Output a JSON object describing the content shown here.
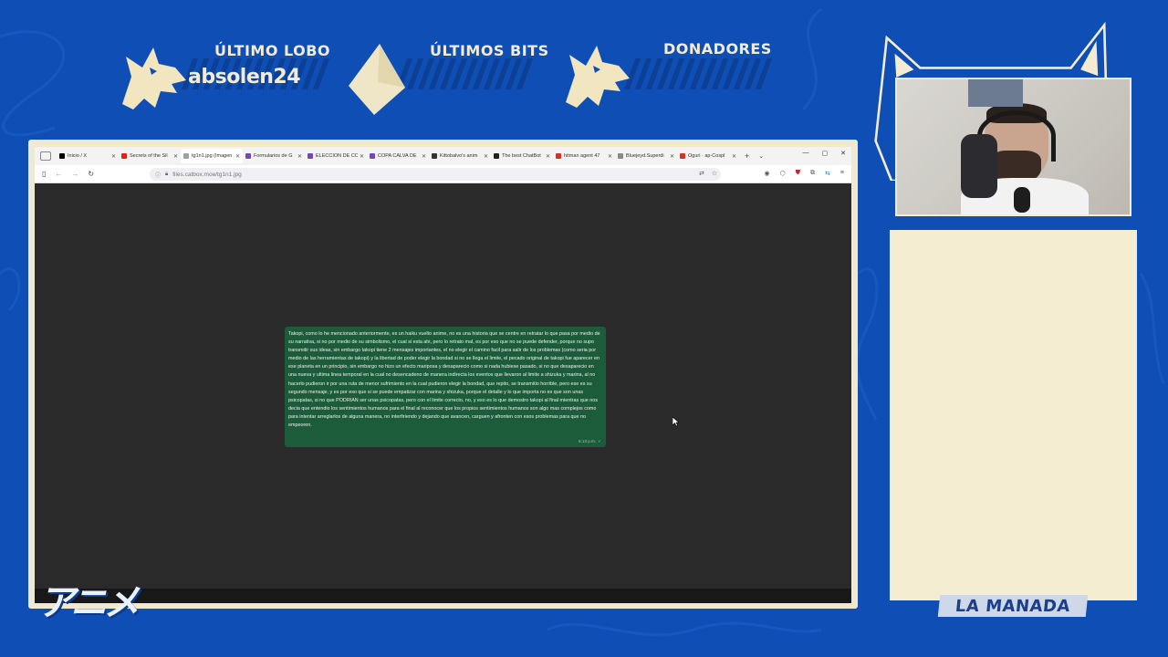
{
  "banner": {
    "last_wolf_label": "ÚLTIMO LOBO",
    "last_wolf_user": "absolen24",
    "last_bits_label": "ÚLTIMOS BITS",
    "donors_label": "DONADORES"
  },
  "browser": {
    "tabs": [
      {
        "title": "Inicio / X",
        "favicon": "x-icon",
        "color": "#000000"
      },
      {
        "title": "Secrets of the Sil",
        "favicon": "youtube-icon",
        "color": "#e62117"
      },
      {
        "title": "tg1n1.jpg (Imagen",
        "favicon": "image-icon",
        "color": "#9aa0a6",
        "active": true
      },
      {
        "title": "Formularios de G",
        "favicon": "forms-icon",
        "color": "#7248b9"
      },
      {
        "title": "ELECCIÓN DE CO",
        "favicon": "forms-icon",
        "color": "#7248b9"
      },
      {
        "title": "COPA CALVA DE",
        "favicon": "forms-icon",
        "color": "#7248b9"
      },
      {
        "title": "Kittobalvo's anim",
        "favicon": "site-icon",
        "color": "#333333"
      },
      {
        "title": "The best ChatBot",
        "favicon": "chatbot-icon",
        "color": "#222222"
      },
      {
        "title": "hitman agent 47",
        "favicon": "red-icon",
        "color": "#d93025"
      },
      {
        "title": "Bluejeyd.Superdi",
        "favicon": "site-icon",
        "color": "#8a8a8a"
      },
      {
        "title": "Oguri · ap-Cospl",
        "favicon": "red-icon",
        "color": "#d93025"
      }
    ],
    "url": "files.catbox.moe/tg1n1.jpg"
  },
  "message": {
    "text": "Takopi, como lo he mencionado anteriormente, es un haiku vuelto anime, no es una historia que se centre en retratar lo que pasa por medio de su narrativa, si no por medio de su simbolismo, el cual si esta ahi, pero lo retrato mal, es por eso que no se puede defender, porque no supo transmitir sus ideas, sin embargo takopi tiene 2 mensajes importantes, el no elegir el camino facil para salir de los problemas (como seria por medio de las herramientas de takopi) y la libertad de poder elegir la bondad si no se llega el limite, el pecado original de takopi fue aparecer en ese planeta en un principio, sin embargo no hizo un efecto mariposa y desaparecio como si nada hubiese pasado, si no que desaparecio en una nueva y ultima linea temporal en la cual no desencadeno de manera indirecta los eventos que llevaron al limite a shizuka y marina, al no hacerlo pudieron ir por una ruta de menor sufrimiento en la cual pudieron elegir la bondad, que repito, se transmitio horrible, pero ese es su segundo mensaje, y es por eso que si se puede empatizar con marina y shizuka, porque el detalle y lo que importa no es que son unas psicopatas, si no que PODRIAN ser unas psicopatas, pero con el limite correcto, no, y eso es lo que demostro takopi al final mientras que nos decia que entendio los sentimientos humanos para el final al reconocer que los propios sentimientos humanos son algo mas complejos como para intentar arreglarlos de alguna manera, no interfiriendo y dejando que avancen, carguen y afronten con esos problemas para que no empeoren.",
    "time": "5:13 p.m."
  },
  "sidebar": {
    "footer_label": "LA MANADA"
  },
  "logo": {
    "text": "アニメ"
  },
  "colors": {
    "background": "#0f4fb5",
    "cream": "#f3ecd2",
    "message_bubble": "#1d5c3b"
  }
}
